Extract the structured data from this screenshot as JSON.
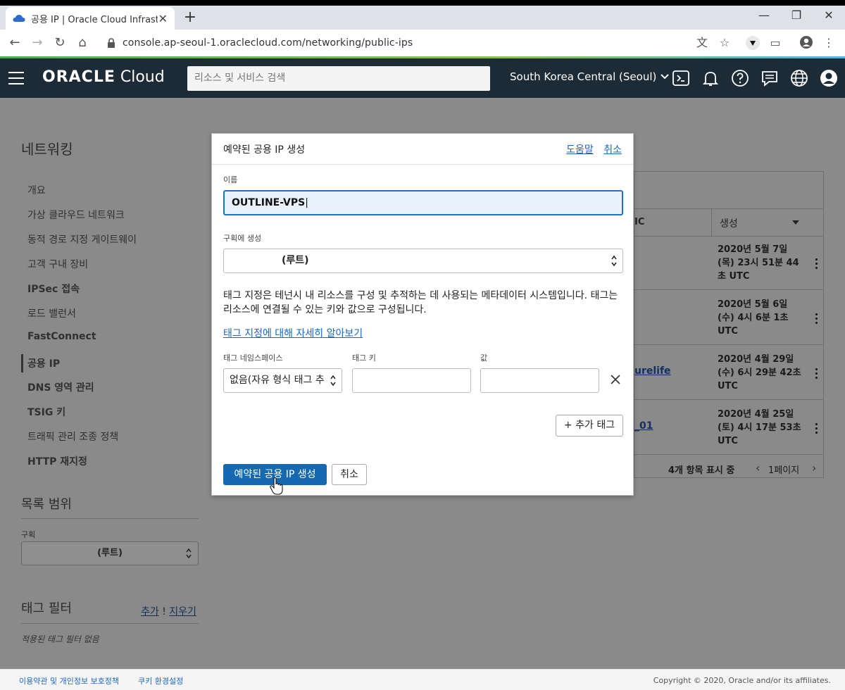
{
  "browser": {
    "tab_title": "공용 IP | Oracle Cloud Infrastruc",
    "url": "console.ap-seoul-1.oraclecloud.com/networking/public-ips"
  },
  "header": {
    "brand_bold": "ORACLE",
    "brand_light": " Cloud",
    "search_placeholder": "리소스 및 서비스 검색",
    "region": "South Korea Central (Seoul)"
  },
  "sidebar": {
    "title": "네트워킹",
    "items": [
      {
        "label": "개요"
      },
      {
        "label": "가상 클라우드 네트워크"
      },
      {
        "label": "동적 경로 지정 게이트웨이"
      },
      {
        "label": "고객 구내 장비"
      },
      {
        "label": "IPSec 접속"
      },
      {
        "label": "로드 밸런서"
      },
      {
        "label": "FastConnect"
      },
      {
        "label": "공용 IP"
      },
      {
        "label": "DNS 영역 관리"
      },
      {
        "label": "TSIG 키"
      },
      {
        "label": "트래픽 관리 조종 정책"
      },
      {
        "label": "HTTP 재지정"
      }
    ],
    "scope_title": "목록 범위",
    "compartment_label": "구획",
    "compartment_value": "(루트)",
    "tag_filter_title": "태그 필터",
    "tag_add": "추가",
    "tag_clear": "지우기",
    "no_tag_filter": "적용된 태그 필터 없음"
  },
  "table": {
    "header_partial": "IC",
    "header_created": "생성",
    "rows": [
      {
        "link": "",
        "created": "2020년 5월 7일 (목) 23시 51분 44초 UTC"
      },
      {
        "link": "",
        "created": "2020년 5월 6일 (수) 4시 6분 1초 UTC"
      },
      {
        "link": "urelife",
        "created": "2020년 4월 29일 (수) 6시 29분 42초 UTC"
      },
      {
        "link": "_01",
        "created": "2020년 4월 25일 (토) 4시 17분 53초 UTC"
      }
    ],
    "footer_count": "4개 항목 표시 중",
    "page": "1페이지"
  },
  "modal": {
    "title": "예약된 공용 IP 생성",
    "help_link": "도움말",
    "cancel_link": "취소",
    "name_label": "이름",
    "name_value": "OUTLINE-VPS",
    "compartment_label": "구획에 생성",
    "compartment_value": "(루트)",
    "tag_description": "태그 지정은 테넌시 내 리소스를 구성 및 추적하는 데 사용되는 메타데이터 시스템입니다. 태그는 리소스에 연결될 수 있는 키와 값으로 구성됩니다.",
    "tag_learn_more": "태그 지정에 대해 자세히 알아보기",
    "namespace_label": "태그 네임스페이스",
    "namespace_value": "없음(자유 형식 태그 추",
    "tag_key_label": "태그 키",
    "tag_value_label": "값",
    "add_tag_button": "+ 추가 태그",
    "create_button": "예약된 공용 IP 생성",
    "cancel_button": "취소"
  },
  "footer": {
    "terms": "이용약관 및 개인정보 보호정책",
    "cookies": "쿠키 환경설정",
    "copyright": "Copyright © 2020, Oracle and/or its affiliates."
  }
}
